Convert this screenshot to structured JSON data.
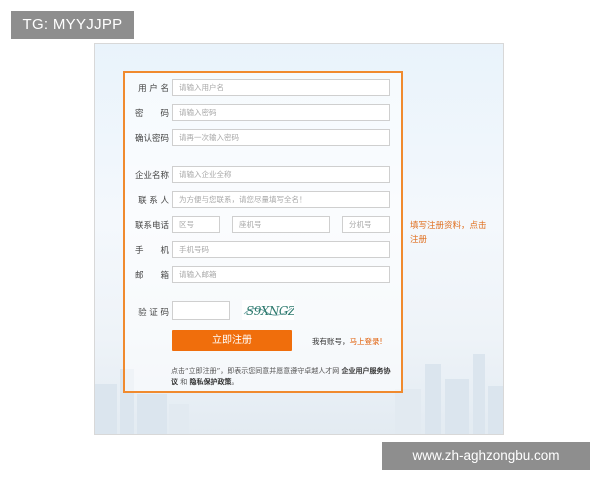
{
  "overlay_tag": "TG: MYYJJPP",
  "watermark": "www.zh-aghzongbu.com",
  "form": {
    "username": {
      "label": "用 户 名",
      "placeholder": "请输入用户名"
    },
    "password": {
      "label": "密　　码",
      "placeholder": "请输入密码"
    },
    "confirm_password": {
      "label": "确认密码",
      "placeholder": "请再一次输入密码"
    },
    "company": {
      "label": "企业名称",
      "placeholder": "请输入企业全称"
    },
    "contact": {
      "label": "联 系 人",
      "placeholder": "为方便与您联系，请您尽量填写全名！"
    },
    "phone": {
      "label": "联系电话",
      "area_placeholder": "区号",
      "main_placeholder": "座机号",
      "ext_placeholder": "分机号"
    },
    "mobile": {
      "label": "手　　机",
      "placeholder": "手机号码"
    },
    "email": {
      "label": "邮　　箱",
      "placeholder": "请输入邮箱"
    },
    "captcha": {
      "label": "验 证 码",
      "image_text": "S9XNGZ"
    }
  },
  "side_hint": "填写注册资料，点击注册",
  "submit_label": "立即注册",
  "have_account": "我有账号，",
  "login_link": "马上登录!",
  "agreement": {
    "prefix": "点击“立即注册”，即表示您同意并愿意遵守卓越人才网",
    "link1": "企业用户服务协议",
    "and": "和",
    "link2": "隐私保护政策",
    "suffix": "。"
  },
  "colors": {
    "accent": "#f06e0c",
    "border_accent": "#f08a2e",
    "hint": "#e07020"
  }
}
